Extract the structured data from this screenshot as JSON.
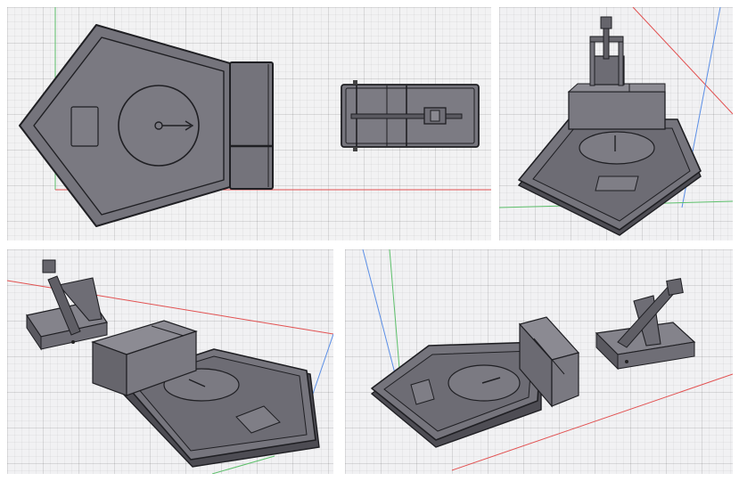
{
  "app": {
    "name": ""
  },
  "colors": {
    "canvas": "#f2f2f3",
    "grid_major": "#d9d9dc",
    "model_fill": "#75747c",
    "model_top": "#85848c",
    "model_dark": "#55545b",
    "model_edge": "#1f1f23",
    "axis_red": "#e25050",
    "axis_green": "#5cbf6a",
    "axis_blue": "#5a8ee6"
  },
  "viewports": [
    {
      "id": "top",
      "view": "top-orthographic",
      "model": "pentagon-base-with-dial-and-catapult-sled"
    },
    {
      "id": "iso-a",
      "view": "isometric-front",
      "model": "pentagon-base-with-assembled-catapult"
    },
    {
      "id": "iso-b",
      "view": "isometric-side",
      "model": "pentagon-base-with-separated-catapult"
    },
    {
      "id": "iso-c",
      "view": "isometric-rear",
      "model": "pentagon-base-with-separated-catapult"
    }
  ]
}
